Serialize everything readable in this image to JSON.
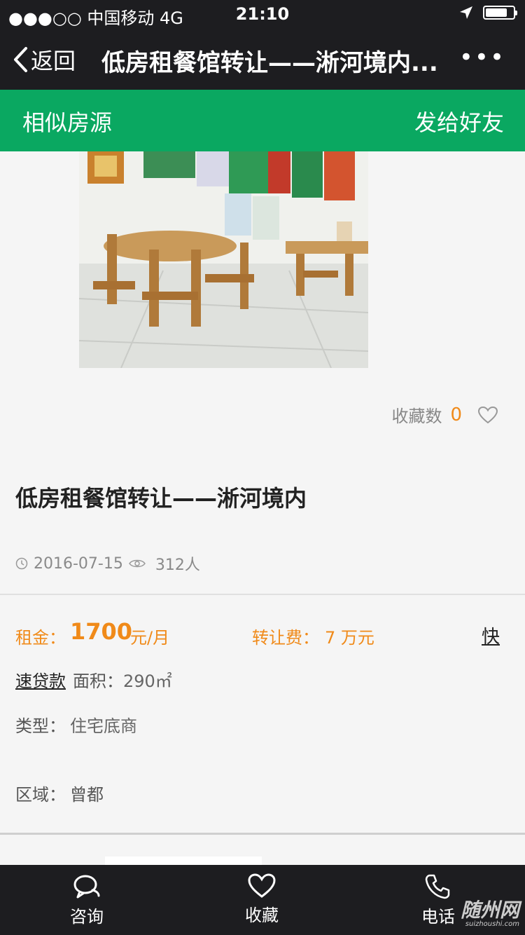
{
  "status": {
    "signal": "●●●○○ 中国移动  4G",
    "time": "21:10"
  },
  "nav": {
    "back_label": "返回",
    "title": "低房租餐馆转让——淅河境内...",
    "more": "•••"
  },
  "toolbar": {
    "similar_label": "相似房源",
    "share_label": "发给好友"
  },
  "favorites": {
    "label": "收藏数",
    "count": "0"
  },
  "listing": {
    "title": "低房租餐馆转让——淅河境内",
    "date": "2016-07-15",
    "views": "312人"
  },
  "details": {
    "rent_label": "租金：",
    "rent_value": "1700",
    "rent_unit": "元/月",
    "fee_label": "转让费：",
    "fee_value": "7 万元",
    "quick_label": "快",
    "loan_link": "速贷款",
    "area_label": "面积：",
    "area_value": "290㎡",
    "type_label": "类型：",
    "type_value": "住宅底商",
    "region_label": "区域：",
    "region_value": "曾都"
  },
  "tabbar": {
    "consult": "咨询",
    "favorite": "收藏",
    "phone": "电话"
  },
  "watermark": {
    "main": "随州网",
    "sub": "suizhoushi.com"
  },
  "colors": {
    "dark": "#1d1d20",
    "green": "#0aa861",
    "accent": "#f08a19"
  }
}
